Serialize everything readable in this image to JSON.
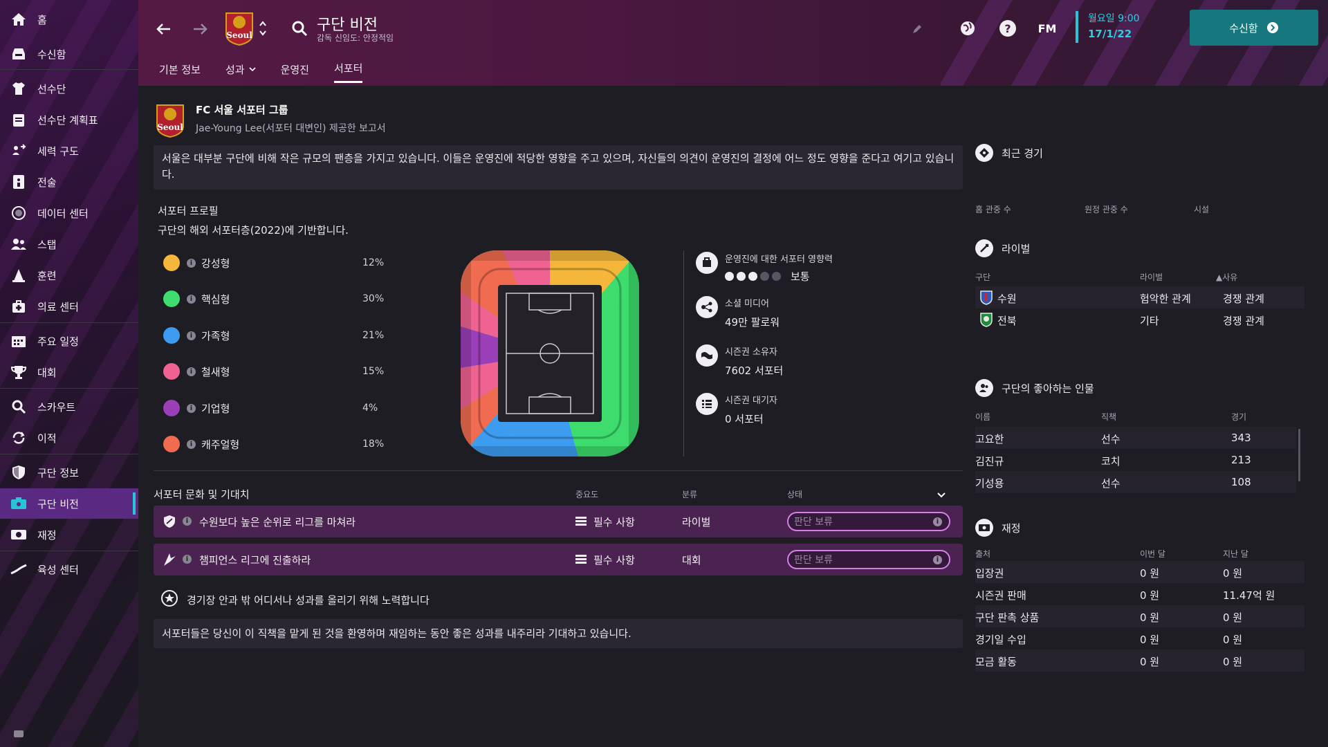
{
  "sidebar": {
    "items": [
      {
        "label": "홈"
      },
      {
        "label": "수신함"
      },
      {
        "label": "선수단"
      },
      {
        "label": "선수단 계획표"
      },
      {
        "label": "세력 구도"
      },
      {
        "label": "전술"
      },
      {
        "label": "데이터 센터"
      },
      {
        "label": "스탭"
      },
      {
        "label": "훈련"
      },
      {
        "label": "의료 센터"
      },
      {
        "label": "주요 일정"
      },
      {
        "label": "대회"
      },
      {
        "label": "스카우트"
      },
      {
        "label": "이적"
      },
      {
        "label": "구단 정보"
      },
      {
        "label": "구단 비전"
      },
      {
        "label": "재정"
      },
      {
        "label": "육성 센터"
      }
    ]
  },
  "header": {
    "title": "구단 비전",
    "subtitle": "감독 신임도: 안정적임",
    "club_logo_text": "Seoul",
    "fm_label": "FM",
    "date_line1": "월요일 9:00",
    "date_line2": "17/1/22",
    "inbox_button": "수신함",
    "tabs": [
      "기본 정보",
      "성과",
      "운영진",
      "서포터"
    ],
    "active_tab": "서포터"
  },
  "main": {
    "group_name": "FC 서울 서포터 그룹",
    "group_sub": "Jae-Young Lee(서포터 대변인) 제공한 보고서",
    "description": "서울은 대부분 구단에 비해 작은 규모의 팬층을 가지고 있습니다. 이들은 운영진에 적당한 영향을 주고 있으며, 자신들의 의견이 운영진의 결정에 어느 정도 영향을 준다고 여기고 있습니다.",
    "profile_title": "서포터 프로필",
    "profile_sub": "구단의 해외 서포터층(2022)에 기반합니다.",
    "profiles": [
      {
        "name": "강성형",
        "pct": "12%",
        "color": "#f5b73a"
      },
      {
        "name": "핵심형",
        "pct": "30%",
        "color": "#3ddc6c"
      },
      {
        "name": "가족형",
        "pct": "21%",
        "color": "#3d9cf0"
      },
      {
        "name": "철새형",
        "pct": "15%",
        "color": "#f06292"
      },
      {
        "name": "기업형",
        "pct": "4%",
        "color": "#9b3fb8"
      },
      {
        "name": "캐주얼형",
        "pct": "18%",
        "color": "#f06b4f"
      }
    ],
    "stats": [
      {
        "title": "운영진에 대한 서포터 영향력",
        "value": "보통",
        "filled": 3,
        "total": 5
      },
      {
        "title": "소셜 미디어",
        "value": "49만 팔로워"
      },
      {
        "title": "시즌권 소유자",
        "value": "7602 서포터"
      },
      {
        "title": "시즌권 대기자",
        "value": "0 서포터"
      }
    ],
    "culture_title": "서포터 문화 및 기대치",
    "culture_cols": [
      "중요도",
      "분류",
      "상태"
    ],
    "expectations": [
      {
        "text": "수원보다 높은 순위로 리그를 마쳐라",
        "importance": "필수 사항",
        "category": "라이벌",
        "status": "판단 보류"
      },
      {
        "text": "챔피언스 리그에 진출하라",
        "importance": "필수 사항",
        "category": "대회",
        "status": "판단 보류"
      }
    ],
    "effort_text": "경기장 안과 밖 어디서나 성과를 올리기 위해 노력합니다",
    "bottom_text": "서포터들은 당신이 이 직책을 맡게 된 것을 환영하며 재임하는 동안 좋은 성과를 내주리라 기대하고 있습니다."
  },
  "right": {
    "recent_title": "최근 경기",
    "recent_cols": [
      "홈 관중 수",
      "원정 관중 수",
      "시설"
    ],
    "rivals_title": "라이벌",
    "rivals_cols": [
      "구단",
      "라이벌",
      "▲사유"
    ],
    "rivals": [
      {
        "club": "수원",
        "rivalry": "험악한 관계",
        "reason": "경쟁 관계"
      },
      {
        "club": "전북",
        "rivalry": "기타",
        "reason": "경쟁 관계"
      }
    ],
    "fav_title": "구단의 좋아하는 인물",
    "fav_cols": [
      "이름",
      "직책",
      "경기"
    ],
    "favs": [
      {
        "name": "고요한",
        "role": "선수",
        "games": "343"
      },
      {
        "name": "김진규",
        "role": "코치",
        "games": "213"
      },
      {
        "name": "기성용",
        "role": "선수",
        "games": "108"
      }
    ],
    "fin_title": "재정",
    "fin_cols": [
      "출처",
      "이번 달",
      "지난 달"
    ],
    "fins": [
      {
        "src": "입장권",
        "this": "0 원",
        "last": "0 원"
      },
      {
        "src": "시즌권 판매",
        "this": "0 원",
        "last": "11.47억 원"
      },
      {
        "src": "구단 판촉 상품",
        "this": "0 원",
        "last": "0 원"
      },
      {
        "src": "경기일 수입",
        "this": "0 원",
        "last": "0 원"
      },
      {
        "src": "모금 활동",
        "this": "0 원",
        "last": "0 원"
      }
    ]
  }
}
